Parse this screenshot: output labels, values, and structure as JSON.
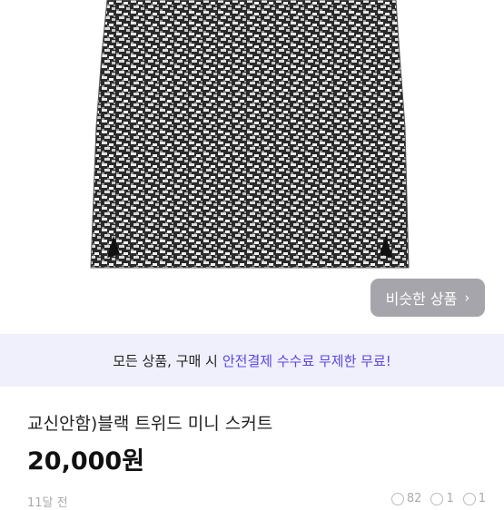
{
  "product": {
    "image_alt": "black tweed mini skirt",
    "similar_button_label": "비슷한 상품",
    "title": "교신안함)블랙 트위드 미니 스커트",
    "price": "20,000원",
    "time_ago": "11달 전",
    "stats": {
      "views": "82",
      "likes": "1",
      "chats": "1"
    }
  },
  "banner": {
    "text_prefix": "모든 상품, 구매 시",
    "text_highlight": "안전결제 수수료 무제한 무료!",
    "highlight_color": "#5b46e8"
  }
}
